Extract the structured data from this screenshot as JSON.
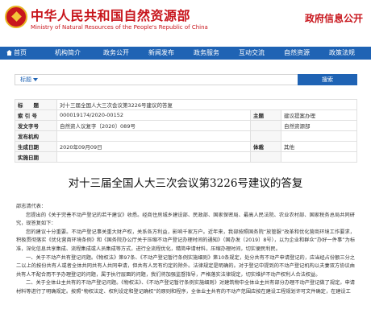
{
  "header": {
    "site_name_cn": "中华人民共和国自然资源部",
    "site_name_en": "Ministry of Natural Resources of the People's Republic of China",
    "gov_info_label": "政府信息公开"
  },
  "nav": {
    "items": [
      "首页",
      "机构简介",
      "政务公开",
      "新闻发布",
      "政务服务",
      "互动交流",
      "自然资源",
      "政策法规"
    ]
  },
  "search": {
    "scope_label": "标题",
    "button_label": "搜索"
  },
  "metadata": {
    "rows": [
      {
        "k1": "标　　题",
        "v1": "对十三届全国人大三次会议第3226号建议的答复",
        "k2": "",
        "v2": ""
      },
      {
        "k1": "索 引 号",
        "v1": "000019174/2020-00152",
        "k2": "主题",
        "v2": "建议提案办理"
      },
      {
        "k1": "发文字号",
        "v1": "自然资人议复字〔2020〕089号",
        "k2": "",
        "v2": "自然资源部"
      },
      {
        "k1": "发布机构",
        "v1": "",
        "k2": "",
        "v2": ""
      },
      {
        "k1": "生成日期",
        "v1": "2020年09月09日",
        "k2": "体裁",
        "v2": "其他"
      },
      {
        "k1": "实施日期",
        "v1": "",
        "k2": "",
        "v2": ""
      }
    ]
  },
  "document": {
    "title": "对十三届全国人大三次会议第3226号建议的答复",
    "greeting": "邵志清代表：",
    "paragraphs": [
      "您提出的《关于完善不动产登记的若干建议》收悉。经商住房城乡建设部、民政部、国家保密局、最高人民法院、农业农村部、国家税务总局共同研究，现答复如下：",
      "您的建议十分重要。不动产登记事关重大财产权，关系各方利益，影响千家万户。近年来，我部按照国务院“放管服”改革和优化营商环境工作要求，积极贯彻落实《优化营商环境条例》和《国务院办公厅关于压缩不动产登记办理时间的通知》（国办发〔2019〕8号），以为企业和群众“办好一件事”为标准，深化信息共享集成、流程集成或人员集成等方式，进行全流程优化，精简申请材料，压缩办理时间，切实便民利民。",
      "一、关于不动产共有登记问题。《物权法》第97条、《不动产登记暂行条例实施细则》第10条规定，处分共有不动产申请登记的，应当经占份额三分之二以上的按份共有人或者全体共同共有人共同申请，但共有人另有约定的除外。法律规定是明确的。对于登记中提到的不动产登记机构以夫妻双方协议由共有人不配合而不予办理登记的问题，属于执行层面的问题，我们将加强监督指导，严格落实法律规定，切实维护不动产权利人合法权益。",
      "二、关于全体业主共有的不动产登记问题。《物权法》、《不动产登记暂行条例实施细则》对建筑物中全体业主共有部分办理不动产登记做了规定。申请材料等进行了明确规定。按照“物权法定、权利设定和登记确权”的原则和程序，全体业主共有的不动产范围应按在建设工程规划许可文件确定，在建设工"
    ]
  }
}
